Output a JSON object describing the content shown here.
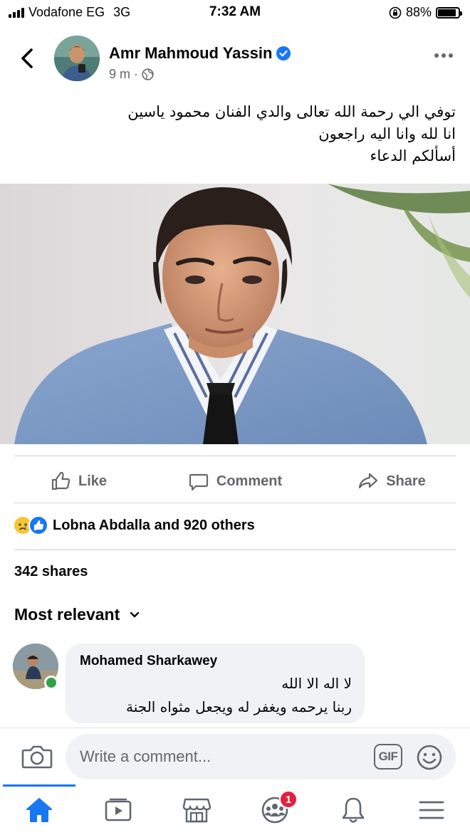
{
  "status_bar": {
    "carrier": "Vodafone EG",
    "network": "3G",
    "time": "7:32 AM",
    "battery": "88%",
    "battery_level": 0.88
  },
  "post": {
    "author": "Amr Mahmoud Yassin",
    "time": "9 m",
    "separator": "·",
    "text_lines": [
      "توفي الي رحمة  الله تعالى والدي الفنان محمود ياسين",
      "انا لله وانا اليه راجعون",
      "أسألكم  الدعاء"
    ]
  },
  "actions": {
    "like": "Like",
    "comment": "Comment",
    "share": "Share"
  },
  "reactions": {
    "summary": "Lobna Abdalla and 920 others"
  },
  "shares": "342 shares",
  "comments_filter": "Most relevant",
  "comment": {
    "author": "Mohamed Sharkawey",
    "lines": [
      "لا اله الا الله",
      "ربنا يرحمه ويغفر له ويجعل مثواه الجنة"
    ]
  },
  "composer": {
    "placeholder": "Write a comment...",
    "gif_label": "GIF"
  },
  "tabbar": {
    "groups_badge": "1"
  },
  "colors": {
    "brand_blue": "#1877f2",
    "secondary_text": "#65676b",
    "badge_red": "#e41e3f",
    "online_green": "#31a24c"
  }
}
